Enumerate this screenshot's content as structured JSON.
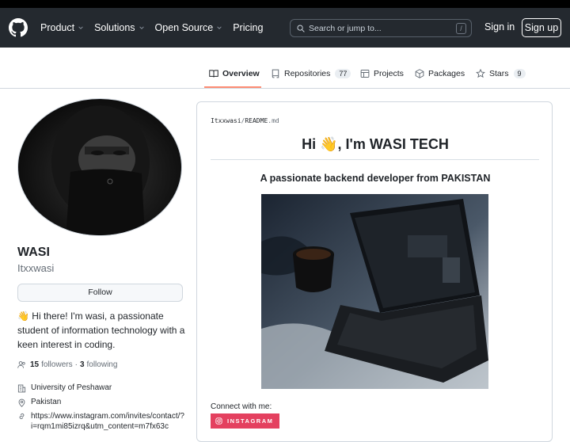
{
  "header": {
    "nav": [
      "Product",
      "Solutions",
      "Open Source",
      "Pricing"
    ],
    "search_placeholder": "Search or jump to...",
    "slash_key": "/",
    "sign_in": "Sign in",
    "sign_up": "Sign up"
  },
  "tabs": {
    "overview": "Overview",
    "repositories": "Repositories",
    "repositories_count": "77",
    "projects": "Projects",
    "packages": "Packages",
    "stars": "Stars",
    "stars_count": "9"
  },
  "profile": {
    "name": "WASI",
    "username": "Itxxwasi",
    "follow": "Follow",
    "bio": "👋 Hi there! I'm wasi, a passionate student of information technology with a keen interest in coding.",
    "followers_count": "15",
    "followers_label": "followers",
    "separator": "·",
    "following_count": "3",
    "following_label": "following",
    "organization": "University of Peshawar",
    "location": "Pakistan",
    "link": "https://www.instagram.com/invites/contact/?i=rqm1mi85izrq&utm_content=m7fx63c"
  },
  "readme": {
    "owner": "Itxxwasi",
    "slash": "/",
    "file": "README",
    "ext": ".md",
    "heading": "Hi 👋, I'm WASI TECH",
    "subheading": "A passionate backend developer from PAKISTAN",
    "connect": "Connect with me:",
    "instagram": "INSTAGRAM"
  },
  "colors": {
    "header_bg": "#24292f",
    "tab_underline": "#fd8c73",
    "instagram": "#e4405f"
  }
}
